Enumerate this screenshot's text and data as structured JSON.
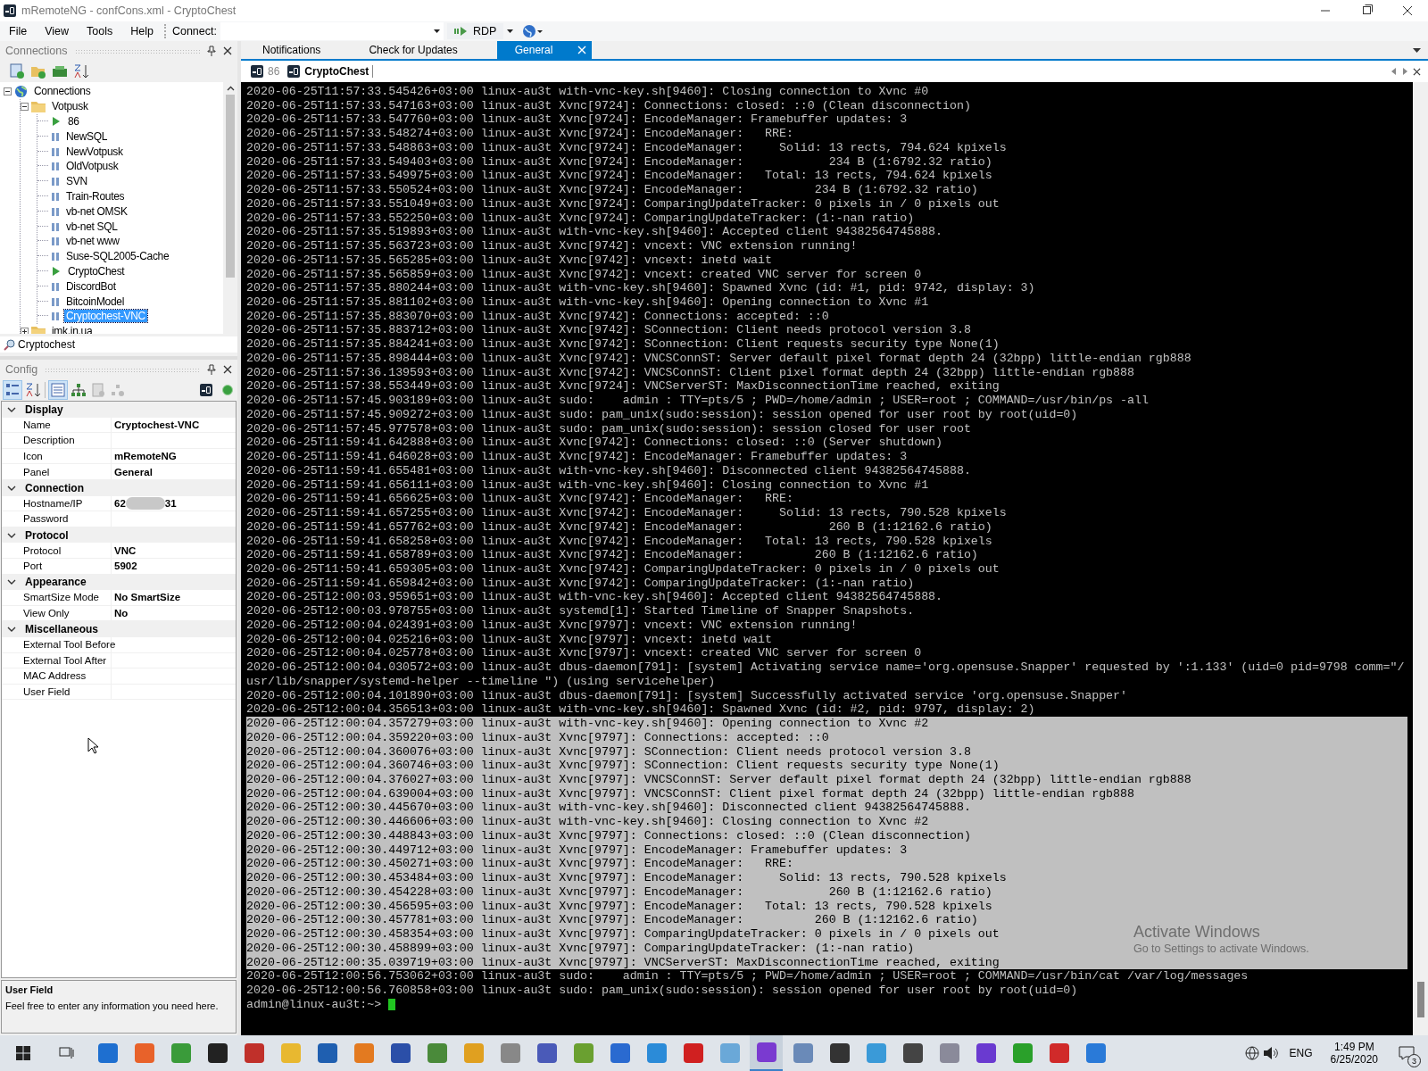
{
  "window": {
    "title": "mRemoteNG - confCons.xml - CryptoChest"
  },
  "menu": [
    "File",
    "View",
    "Tools",
    "Help"
  ],
  "toolbar": {
    "connect_label": "Connect:",
    "protocol": "RDP"
  },
  "connections_panel": {
    "title": "Connections",
    "tree": [
      {
        "label": "Connections",
        "kind": "root",
        "expanded": true,
        "selected": false,
        "children": [
          {
            "label": "Votpusk",
            "kind": "folder",
            "expanded": true,
            "selected": false,
            "children": [
              {
                "label": "86",
                "kind": "connection",
                "connected": true,
                "selected": false
              },
              {
                "label": "NewSQL",
                "kind": "connection",
                "connected": false,
                "selected": false
              },
              {
                "label": "NewVotpusk",
                "kind": "connection",
                "connected": false,
                "selected": false
              },
              {
                "label": "OldVotpusk",
                "kind": "connection",
                "connected": false,
                "selected": false
              },
              {
                "label": "SVN",
                "kind": "connection",
                "connected": false,
                "selected": false
              },
              {
                "label": "Train-Routes",
                "kind": "connection",
                "connected": false,
                "selected": false
              },
              {
                "label": "vb-net OMSK",
                "kind": "connection",
                "connected": false,
                "selected": false
              },
              {
                "label": "vb-net SQL",
                "kind": "connection",
                "connected": false,
                "selected": false
              },
              {
                "label": "vb-net www",
                "kind": "connection",
                "connected": false,
                "selected": false
              },
              {
                "label": "Suse-SQL2005-Cache",
                "kind": "connection",
                "connected": false,
                "selected": false
              },
              {
                "label": "CryptoChest",
                "kind": "connection",
                "connected": true,
                "selected": false
              },
              {
                "label": "DiscordBot",
                "kind": "connection",
                "connected": false,
                "selected": false
              },
              {
                "label": "BitcoinModel",
                "kind": "connection",
                "connected": false,
                "selected": false
              },
              {
                "label": "Cryptochest-VNC",
                "kind": "connection",
                "connected": false,
                "selected": true
              }
            ]
          },
          {
            "label": "imk.in.ua",
            "kind": "folder",
            "expanded": false,
            "selected": false
          }
        ]
      }
    ],
    "search": {
      "value": "Cryptochest"
    }
  },
  "config_panel": {
    "title": "Config",
    "categories": [
      {
        "name": "Display",
        "expanded": true,
        "rows": [
          {
            "label": "Name",
            "value": "Cryptochest-VNC"
          },
          {
            "label": "Description"
          },
          {
            "label": "Icon",
            "value": "mRemoteNG"
          },
          {
            "label": "Panel",
            "value": "General"
          }
        ]
      },
      {
        "name": "Connection",
        "expanded": true,
        "rows": [
          {
            "label": "Hostname/IP",
            "value": "62",
            "value_end": "31",
            "redacted": true
          },
          {
            "label": "Password"
          }
        ]
      },
      {
        "name": "Protocol",
        "expanded": true,
        "rows": [
          {
            "label": "Protocol",
            "value": "VNC"
          },
          {
            "label": "Port",
            "value": "5902"
          }
        ]
      },
      {
        "name": "Appearance",
        "expanded": true,
        "rows": [
          {
            "label": "SmartSize Mode",
            "value": "No SmartSize"
          },
          {
            "label": "View Only",
            "value": "No"
          }
        ]
      },
      {
        "name": "Miscellaneous",
        "expanded": true,
        "rows": [
          {
            "label": "External Tool Before"
          },
          {
            "label": "External Tool After"
          },
          {
            "label": "MAC Address"
          },
          {
            "label": "User Field"
          }
        ]
      }
    ],
    "help": {
      "title": "User Field",
      "text": "Feel free to enter any information you need here."
    }
  },
  "document_tabs": [
    {
      "label": "Notifications",
      "selected": false
    },
    {
      "label": "Check for Updates",
      "selected": false
    },
    {
      "label": "General",
      "selected": true
    }
  ],
  "connection_tabs": [
    {
      "label": "86",
      "selected": false
    },
    {
      "label": "CryptoChest",
      "selected": true
    }
  ],
  "terminal": {
    "lines": [
      {
        "text": "2020-06-25T11:57:33.545426+03:00 linux-au3t with-vnc-key.sh[9460]: Closing connection to Xvnc #0",
        "selected": false
      },
      {
        "text": "2020-06-25T11:57:33.547163+03:00 linux-au3t Xvnc[9724]: Connections: closed: ::0 (Clean disconnection)",
        "selected": false
      },
      {
        "text": "2020-06-25T11:57:33.547760+03:00 linux-au3t Xvnc[9724]: EncodeManager: Framebuffer updates: 3",
        "selected": false
      },
      {
        "text": "2020-06-25T11:57:33.548274+03:00 linux-au3t Xvnc[9724]: EncodeManager:   RRE:",
        "selected": false
      },
      {
        "text": "2020-06-25T11:57:33.548863+03:00 linux-au3t Xvnc[9724]: EncodeManager:     Solid: 13 rects, 794.624 kpixels",
        "selected": false
      },
      {
        "text": "2020-06-25T11:57:33.549403+03:00 linux-au3t Xvnc[9724]: EncodeManager:            234 B (1:6792.32 ratio)",
        "selected": false
      },
      {
        "text": "2020-06-25T11:57:33.549975+03:00 linux-au3t Xvnc[9724]: EncodeManager:   Total: 13 rects, 794.624 kpixels",
        "selected": false
      },
      {
        "text": "2020-06-25T11:57:33.550524+03:00 linux-au3t Xvnc[9724]: EncodeManager:          234 B (1:6792.32 ratio)",
        "selected": false
      },
      {
        "text": "2020-06-25T11:57:33.551049+03:00 linux-au3t Xvnc[9724]: ComparingUpdateTracker: 0 pixels in / 0 pixels out",
        "selected": false
      },
      {
        "text": "2020-06-25T11:57:33.552250+03:00 linux-au3t Xvnc[9724]: ComparingUpdateTracker: (1:-nan ratio)",
        "selected": false
      },
      {
        "text": "2020-06-25T11:57:35.519893+03:00 linux-au3t with-vnc-key.sh[9460]: Accepted client 94382564745888.",
        "selected": false
      },
      {
        "text": "2020-06-25T11:57:35.563723+03:00 linux-au3t Xvnc[9742]: vncext: VNC extension running!",
        "selected": false
      },
      {
        "text": "2020-06-25T11:57:35.565285+03:00 linux-au3t Xvnc[9742]: vncext: inetd wait",
        "selected": false
      },
      {
        "text": "2020-06-25T11:57:35.565859+03:00 linux-au3t Xvnc[9742]: vncext: created VNC server for screen 0",
        "selected": false
      },
      {
        "text": "2020-06-25T11:57:35.880244+03:00 linux-au3t with-vnc-key.sh[9460]: Spawned Xvnc (id: #1, pid: 9742, display: 3)",
        "selected": false
      },
      {
        "text": "2020-06-25T11:57:35.881102+03:00 linux-au3t with-vnc-key.sh[9460]: Opening connection to Xvnc #1",
        "selected": false
      },
      {
        "text": "2020-06-25T11:57:35.883070+03:00 linux-au3t Xvnc[9742]: Connections: accepted: ::0",
        "selected": false
      },
      {
        "text": "2020-06-25T11:57:35.883712+03:00 linux-au3t Xvnc[9742]: SConnection: Client needs protocol version 3.8",
        "selected": false
      },
      {
        "text": "2020-06-25T11:57:35.884241+03:00 linux-au3t Xvnc[9742]: SConnection: Client requests security type None(1)",
        "selected": false
      },
      {
        "text": "2020-06-25T11:57:35.898444+03:00 linux-au3t Xvnc[9742]: VNCSConnST: Server default pixel format depth 24 (32bpp) little-endian rgb888",
        "selected": false
      },
      {
        "text": "2020-06-25T11:57:36.139593+03:00 linux-au3t Xvnc[9742]: VNCSConnST: Client pixel format depth 24 (32bpp) little-endian rgb888",
        "selected": false
      },
      {
        "text": "2020-06-25T11:57:38.553449+03:00 linux-au3t Xvnc[9724]: VNCServerST: MaxDisconnectionTime reached, exiting",
        "selected": false
      },
      {
        "text": "2020-06-25T11:57:45.903189+03:00 linux-au3t sudo:    admin : TTY=pts/5 ; PWD=/home/admin ; USER=root ; COMMAND=/usr/bin/ps -all",
        "selected": false
      },
      {
        "text": "2020-06-25T11:57:45.909272+03:00 linux-au3t sudo: pam_unix(sudo:session): session opened for user root by root(uid=0)",
        "selected": false
      },
      {
        "text": "2020-06-25T11:57:45.977578+03:00 linux-au3t sudo: pam_unix(sudo:session): session closed for user root",
        "selected": false
      },
      {
        "text": "2020-06-25T11:59:41.642888+03:00 linux-au3t Xvnc[9742]: Connections: closed: ::0 (Server shutdown)",
        "selected": false
      },
      {
        "text": "2020-06-25T11:59:41.646028+03:00 linux-au3t Xvnc[9742]: EncodeManager: Framebuffer updates: 3",
        "selected": false
      },
      {
        "text": "2020-06-25T11:59:41.655481+03:00 linux-au3t with-vnc-key.sh[9460]: Disconnected client 94382564745888.",
        "selected": false
      },
      {
        "text": "2020-06-25T11:59:41.656111+03:00 linux-au3t with-vnc-key.sh[9460]: Closing connection to Xvnc #1",
        "selected": false
      },
      {
        "text": "2020-06-25T11:59:41.656625+03:00 linux-au3t Xvnc[9742]: EncodeManager:   RRE:",
        "selected": false
      },
      {
        "text": "2020-06-25T11:59:41.657255+03:00 linux-au3t Xvnc[9742]: EncodeManager:     Solid: 13 rects, 790.528 kpixels",
        "selected": false
      },
      {
        "text": "2020-06-25T11:59:41.657762+03:00 linux-au3t Xvnc[9742]: EncodeManager:            260 B (1:12162.6 ratio)",
        "selected": false
      },
      {
        "text": "2020-06-25T11:59:41.658258+03:00 linux-au3t Xvnc[9742]: EncodeManager:   Total: 13 rects, 790.528 kpixels",
        "selected": false
      },
      {
        "text": "2020-06-25T11:59:41.658789+03:00 linux-au3t Xvnc[9742]: EncodeManager:          260 B (1:12162.6 ratio)",
        "selected": false
      },
      {
        "text": "2020-06-25T11:59:41.659305+03:00 linux-au3t Xvnc[9742]: ComparingUpdateTracker: 0 pixels in / 0 pixels out",
        "selected": false
      },
      {
        "text": "2020-06-25T11:59:41.659842+03:00 linux-au3t Xvnc[9742]: ComparingUpdateTracker: (1:-nan ratio)",
        "selected": false
      },
      {
        "text": "2020-06-25T12:00:03.959651+03:00 linux-au3t with-vnc-key.sh[9460]: Accepted client 94382564745888.",
        "selected": false
      },
      {
        "text": "2020-06-25T12:00:03.978755+03:00 linux-au3t systemd[1]: Started Timeline of Snapper Snapshots.",
        "selected": false
      },
      {
        "text": "2020-06-25T12:00:04.024391+03:00 linux-au3t Xvnc[9797]: vncext: VNC extension running!",
        "selected": false
      },
      {
        "text": "2020-06-25T12:00:04.025216+03:00 linux-au3t Xvnc[9797]: vncext: inetd wait",
        "selected": false
      },
      {
        "text": "2020-06-25T12:00:04.025778+03:00 linux-au3t Xvnc[9797]: vncext: created VNC server for screen 0",
        "selected": false
      },
      {
        "text": "2020-06-25T12:00:04.030572+03:00 linux-au3t dbus-daemon[791]: [system] Activating service name='org.opensuse.Snapper' requested by ':1.133' (uid=0 pid=9798 comm=\"/usr/lib/snapper/systemd-helper --timeline \") (using servicehelper)",
        "selected": false
      },
      {
        "text": "2020-06-25T12:00:04.101890+03:00 linux-au3t dbus-daemon[791]: [system] Successfully activated service 'org.opensuse.Snapper'",
        "selected": false
      },
      {
        "text": "2020-06-25T12:00:04.356513+03:00 linux-au3t with-vnc-key.sh[9460]: Spawned Xvnc (id: #2, pid: 9797, display: 2)",
        "selected": false
      },
      {
        "text": "2020-06-25T12:00:04.357279+03:00 linux-au3t with-vnc-key.sh[9460]: Opening connection to Xvnc #2",
        "selected": true
      },
      {
        "text": "2020-06-25T12:00:04.359220+03:00 linux-au3t Xvnc[9797]: Connections: accepted: ::0",
        "selected": true
      },
      {
        "text": "2020-06-25T12:00:04.360076+03:00 linux-au3t Xvnc[9797]: SConnection: Client needs protocol version 3.8",
        "selected": true
      },
      {
        "text": "2020-06-25T12:00:04.360746+03:00 linux-au3t Xvnc[9797]: SConnection: Client requests security type None(1)",
        "selected": true
      },
      {
        "text": "2020-06-25T12:00:04.376027+03:00 linux-au3t Xvnc[9797]: VNCSConnST: Server default pixel format depth 24 (32bpp) little-endian rgb888",
        "selected": true
      },
      {
        "text": "2020-06-25T12:00:04.639004+03:00 linux-au3t Xvnc[9797]: VNCSConnST: Client pixel format depth 24 (32bpp) little-endian rgb888",
        "selected": true
      },
      {
        "text": "2020-06-25T12:00:30.445670+03:00 linux-au3t with-vnc-key.sh[9460]: Disconnected client 94382564745888.",
        "selected": true
      },
      {
        "text": "2020-06-25T12:00:30.446606+03:00 linux-au3t with-vnc-key.sh[9460]: Closing connection to Xvnc #2",
        "selected": true
      },
      {
        "text": "2020-06-25T12:00:30.448843+03:00 linux-au3t Xvnc[9797]: Connections: closed: ::0 (Clean disconnection)",
        "selected": true
      },
      {
        "text": "2020-06-25T12:00:30.449712+03:00 linux-au3t Xvnc[9797]: EncodeManager: Framebuffer updates: 3",
        "selected": true
      },
      {
        "text": "2020-06-25T12:00:30.450271+03:00 linux-au3t Xvnc[9797]: EncodeManager:   RRE:",
        "selected": true
      },
      {
        "text": "2020-06-25T12:00:30.453484+03:00 linux-au3t Xvnc[9797]: EncodeManager:     Solid: 13 rects, 790.528 kpixels",
        "selected": true
      },
      {
        "text": "2020-06-25T12:00:30.454228+03:00 linux-au3t Xvnc[9797]: EncodeManager:            260 B (1:12162.6 ratio)",
        "selected": true
      },
      {
        "text": "2020-06-25T12:00:30.456595+03:00 linux-au3t Xvnc[9797]: EncodeManager:   Total: 13 rects, 790.528 kpixels",
        "selected": true
      },
      {
        "text": "2020-06-25T12:00:30.457781+03:00 linux-au3t Xvnc[9797]: EncodeManager:          260 B (1:12162.6 ratio)",
        "selected": true
      },
      {
        "text": "2020-06-25T12:00:30.458354+03:00 linux-au3t Xvnc[9797]: ComparingUpdateTracker: 0 pixels in / 0 pixels out",
        "selected": true
      },
      {
        "text": "2020-06-25T12:00:30.458899+03:00 linux-au3t Xvnc[9797]: ComparingUpdateTracker: (1:-nan ratio)",
        "selected": true
      },
      {
        "text": "2020-06-25T12:00:35.039719+03:00 linux-au3t Xvnc[9797]: VNCServerST: MaxDisconnectionTime reached, exiting",
        "selected": true
      },
      {
        "text": "2020-06-25T12:00:56.753062+03:00 linux-au3t sudo:    admin : TTY=pts/5 ; PWD=/home/admin ; USER=root ; COMMAND=/usr/bin/cat /var/log/messages",
        "selected": false
      },
      {
        "text": "2020-06-25T12:00:56.760858+03:00 linux-au3t sudo: pam_unix(sudo:session): session opened for user root by root(uid=0)",
        "selected": false
      }
    ],
    "prompt": "admin@linux-au3t:~>"
  },
  "activation_notice": {
    "title": "Activate Windows",
    "text": "Go to Settings to activate Windows."
  },
  "taskbar": {
    "language": "ENG",
    "time": "1:49 PM",
    "date": "6/25/2020",
    "notifications": "3"
  }
}
